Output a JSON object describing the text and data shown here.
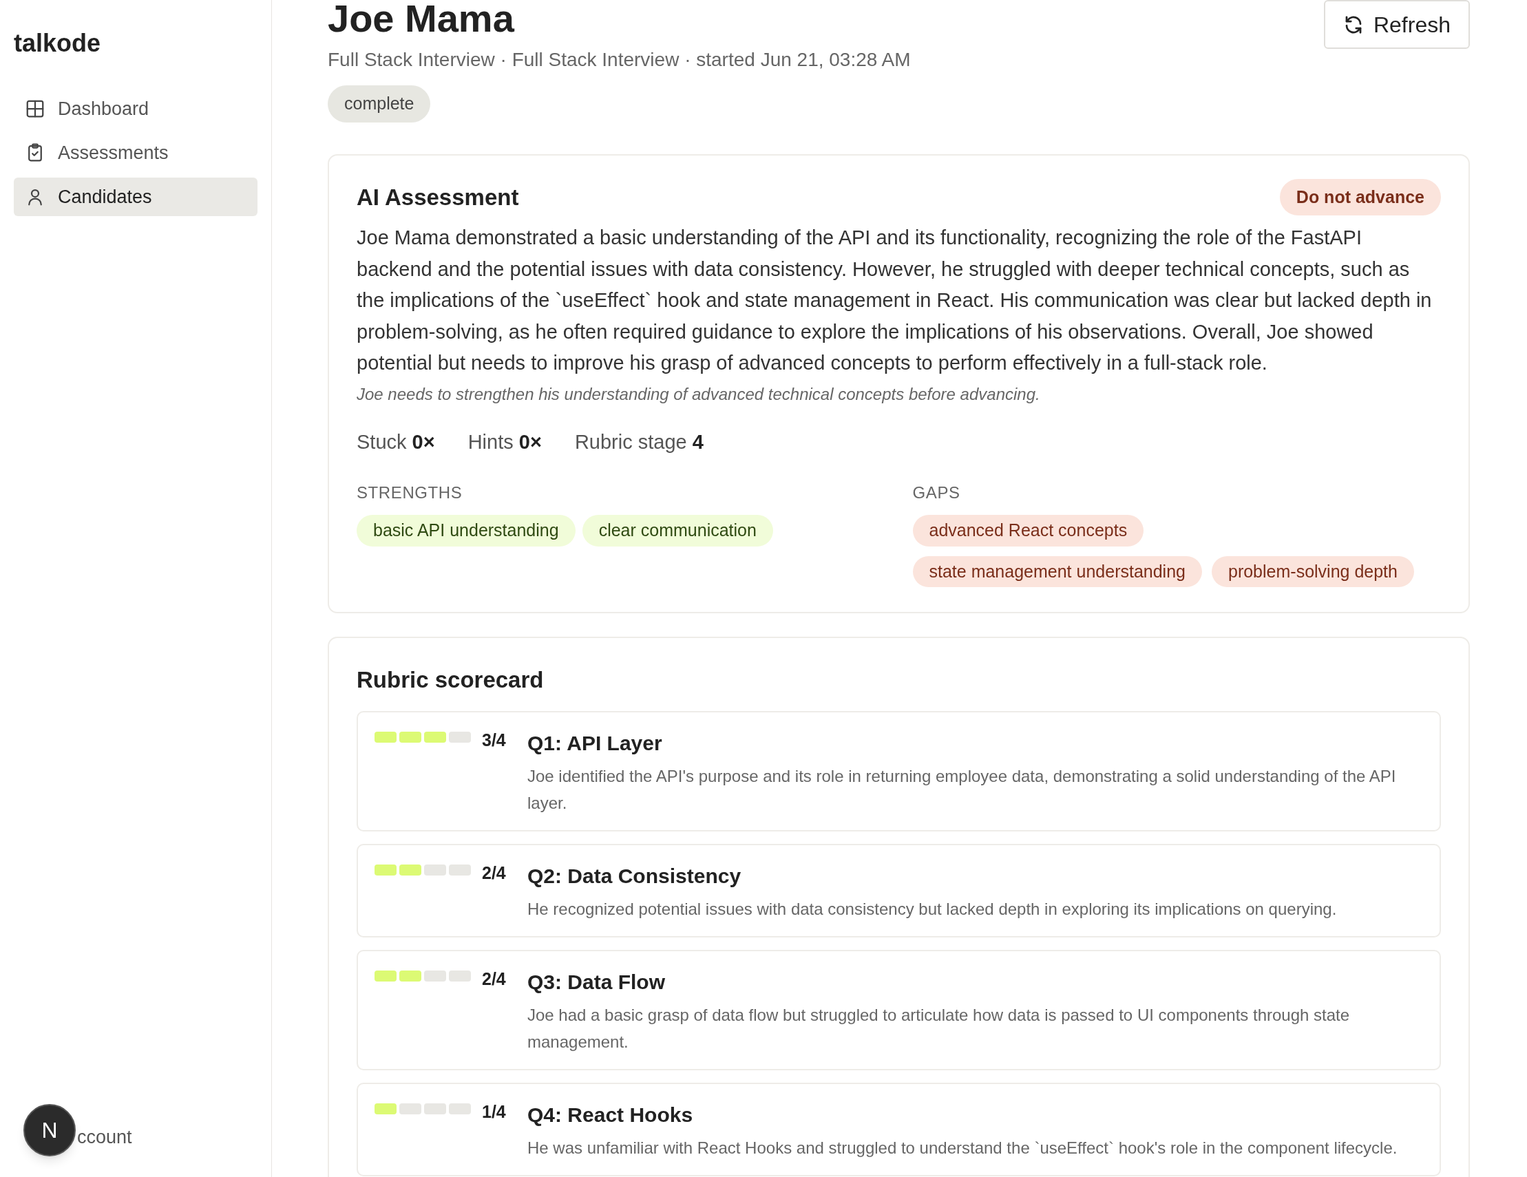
{
  "sidebar": {
    "brand": "talkode",
    "items": [
      {
        "label": "Dashboard",
        "selected": false
      },
      {
        "label": "Assessments",
        "selected": false
      },
      {
        "label": "Candidates",
        "selected": true
      }
    ],
    "account": {
      "avatar": "N",
      "label": "ccount"
    }
  },
  "header": {
    "title": "Joe Mama",
    "subtitle": "Full Stack Interview · Full Stack Interview · started Jun 21, 03:28 AM",
    "status": "complete",
    "refresh": "Refresh"
  },
  "assessment": {
    "title": "AI Assessment",
    "verdict": "Do not advance",
    "summary": "Joe Mama demonstrated a basic understanding of the API and its functionality, recognizing the role of the FastAPI backend and the potential issues with data consistency. However, he struggled with deeper technical concepts, such as the implications of the `useEffect` hook and state management in React. His communication was clear but lacked depth in problem-solving, as he often required guidance to explore the implications of his observations. Overall, Joe showed potential but needs to improve his grasp of advanced concepts to perform effectively in a full-stack role.",
    "note": "Joe needs to strengthen his understanding of advanced technical concepts before advancing.",
    "stats": [
      {
        "label": "Stuck",
        "value": "0×"
      },
      {
        "label": "Hints",
        "value": "0×"
      },
      {
        "label": "Rubric stage",
        "value": "4"
      }
    ],
    "strengths": {
      "heading": "STRENGTHS",
      "tags": [
        "basic API understanding",
        "clear communication"
      ]
    },
    "gaps": {
      "heading": "GAPS",
      "tags": [
        "advanced React concepts",
        "state management understanding",
        "problem-solving depth"
      ]
    }
  },
  "scorecard": {
    "title": "Rubric scorecard",
    "items": [
      {
        "stars": 3,
        "score": "3/4",
        "title": "Q1: API Layer",
        "text": "Joe identified the API's purpose and its role in returning employee data, demonstrating a solid understanding of the API layer."
      },
      {
        "stars": 2,
        "score": "2/4",
        "title": "Q2: Data Consistency",
        "text": "He recognized potential issues with data consistency but lacked depth in exploring its implications on querying."
      },
      {
        "stars": 2,
        "score": "2/4",
        "title": "Q3: Data Flow",
        "text": "Joe had a basic grasp of data flow but struggled to articulate how data is passed to UI components through state management."
      },
      {
        "stars": 1,
        "score": "1/4",
        "title": "Q4: React Hooks",
        "text": "He was unfamiliar with React Hooks and struggled to understand the `useEffect` hook's role in the component lifecycle."
      }
    ]
  }
}
